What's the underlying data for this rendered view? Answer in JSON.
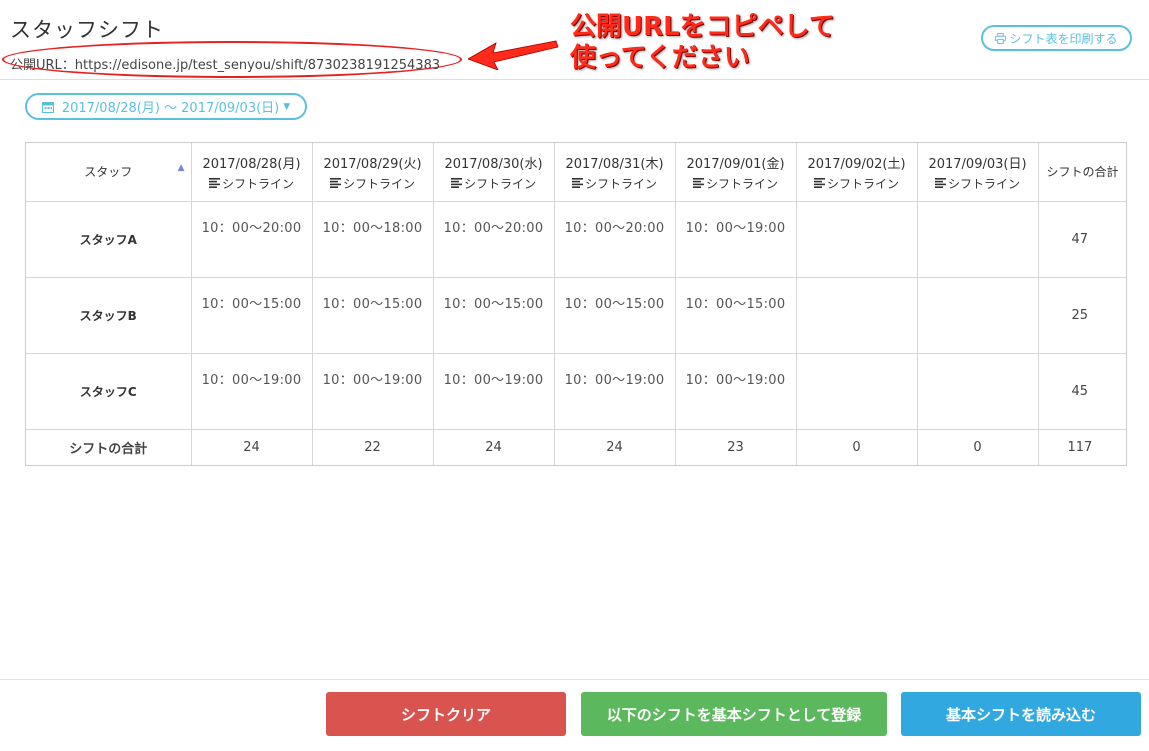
{
  "page": {
    "title": "スタッフシフト",
    "public_url": "公開URL：https://edisone.jp/test_senyou/shift/8730238191254383"
  },
  "annotation": {
    "line1": "公開URLをコピペして",
    "line2": "使ってください",
    "color": "#ff2a1a"
  },
  "toolbar": {
    "print_label": "シフト表を印刷する",
    "date_range": "2017/08/28(月) 〜 2017/09/03(日)"
  },
  "table": {
    "staff_header": "スタッフ",
    "total_header": "シフトの合計",
    "shiftline_label": "シフトライン",
    "days": [
      "2017/08/28(月)",
      "2017/08/29(火)",
      "2017/08/30(水)",
      "2017/08/31(木)",
      "2017/09/01(金)",
      "2017/09/02(土)",
      "2017/09/03(日)"
    ],
    "rows": [
      {
        "name": "スタッフA",
        "shifts": [
          "10：00〜20:00",
          "10：00〜18:00",
          "10：00〜20:00",
          "10：00〜20:00",
          "10：00〜19:00",
          "",
          ""
        ],
        "total": "47"
      },
      {
        "name": "スタッフB",
        "shifts": [
          "10：00〜15:00",
          "10：00〜15:00",
          "10：00〜15:00",
          "10：00〜15:00",
          "10：00〜15:00",
          "",
          ""
        ],
        "total": "25"
      },
      {
        "name": "スタッフC",
        "shifts": [
          "10：00〜19:00",
          "10：00〜19:00",
          "10：00〜19:00",
          "10：00〜19:00",
          "10：00〜19:00",
          "",
          ""
        ],
        "total": "45"
      }
    ],
    "sum_label": "シフトの合計",
    "day_totals": [
      "24",
      "22",
      "24",
      "24",
      "23",
      "0",
      "0"
    ],
    "grand_total": "117"
  },
  "footer": {
    "clear_label": "シフトクリア",
    "register_label": "以下のシフトを基本シフトとして登録",
    "load_label": "基本シフトを読み込む"
  },
  "colors": {
    "accent": "#5bc0de",
    "danger": "#d9534f",
    "success": "#5cb85c",
    "primary": "#31a8e0"
  }
}
